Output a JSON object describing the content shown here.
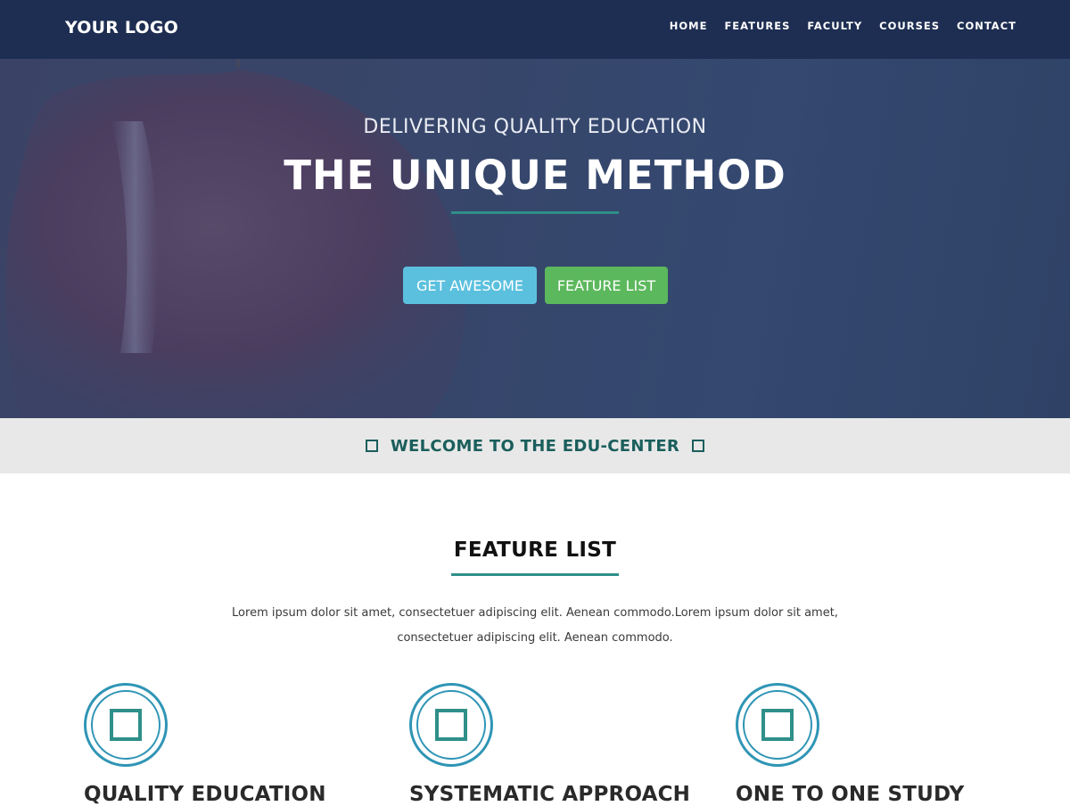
{
  "header": {
    "logo": "YOUR LOGO",
    "nav": [
      {
        "label": "HOME"
      },
      {
        "label": "FEATURES"
      },
      {
        "label": "FACULTY"
      },
      {
        "label": "COURSES"
      },
      {
        "label": "CONTACT"
      }
    ]
  },
  "hero": {
    "subtitle": "DELIVERING QUALITY EDUCATION",
    "title": "THE UNIQUE METHOD",
    "buttons": [
      {
        "label": "GET AWESOME",
        "color": "#5bc0de"
      },
      {
        "label": "FEATURE LIST",
        "color": "#5cb85c"
      }
    ]
  },
  "welcome": {
    "text": "WELCOME TO THE EDU-CENTER",
    "icon": "square-outline-icon"
  },
  "features_section": {
    "title": "FEATURE LIST",
    "description": "Lorem ipsum dolor sit amet, consectetuer adipiscing elit. Aenean commodo.Lorem ipsum dolor sit amet, consectetuer adipiscing elit. Aenean commodo.",
    "items": [
      {
        "title": "QUALITY EDUCATION",
        "icon": "square-icon"
      },
      {
        "title": "SYSTEMATIC APPROACH",
        "icon": "square-icon"
      },
      {
        "title": "ONE TO ONE STUDY",
        "icon": "square-icon"
      }
    ]
  },
  "colors": {
    "navbar": "#1e2e52",
    "accent_teal": "#2f8f89",
    "icon_blue": "#2f95b5",
    "button_info": "#5bc0de",
    "button_success": "#5cb85c"
  }
}
